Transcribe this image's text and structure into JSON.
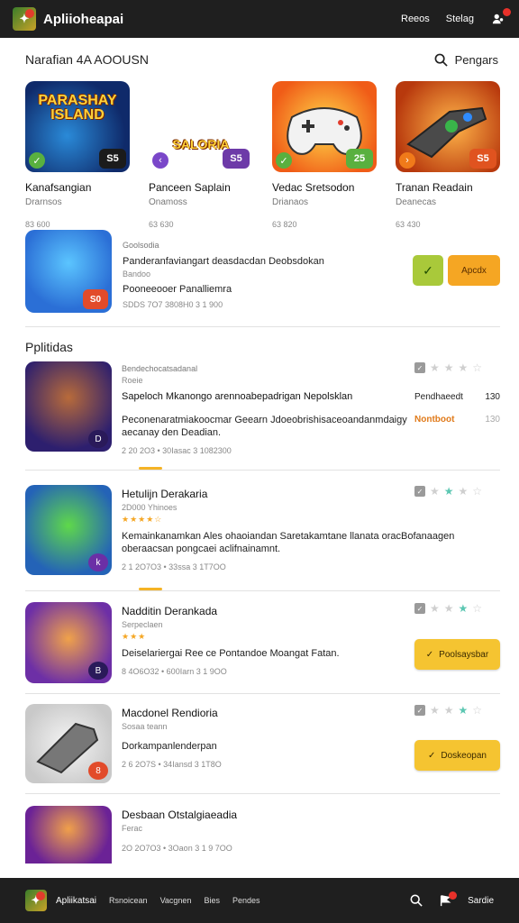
{
  "app": {
    "title": "Apliioheapai"
  },
  "topnav": {
    "item1": "Reeos",
    "item2": "Stelag",
    "icon": "user-icon"
  },
  "section1": {
    "title": "Narafian 4A AOOUSN",
    "search_label": "Pengars"
  },
  "cards": [
    {
      "art": "PARASHAY ISLAND",
      "score": "S5",
      "name": "Kanafsangian",
      "sub": "Drarnsos",
      "stat": "83 600"
    },
    {
      "art": "SALORIA",
      "score": "S5",
      "name": "Panceen Saplain",
      "sub": "Onamoss",
      "stat": "63 630"
    },
    {
      "art": "",
      "score": "25",
      "name": "Vedac Sretsodon",
      "sub": "Drianaos",
      "stat": "63 820"
    },
    {
      "art": "",
      "score": "S5",
      "name": "Tranan Readain",
      "sub": "Deanecas",
      "stat": "63 430"
    }
  ],
  "featured": {
    "label": "Goolsodia",
    "headline": "Panderanfaviangart deasdacdan Deobsdokan",
    "sub": "Bandoo",
    "title": "Pooneeooer Panalliemra",
    "meta": "SDDS 7O7 3808H0 3 1 900",
    "score": "S0",
    "accept_label": "Apcdx"
  },
  "section2": {
    "title": "Pplitidas"
  },
  "items": [
    {
      "category": "Bendechocatsadanal",
      "sub": "Roeie",
      "title": "Sapeloch Mkanongo arennoabepadrigan Nepolsklan",
      "desc": "Peconenaratmiakoocmar Geearn Jdoeobrishisaceoandanmdaigy aecanay den Deadian.",
      "meta": "2 20 2O3 • 30Iasac 3 1082300",
      "num": "D",
      "side1": "Pendhaeedt",
      "side1v": "130",
      "side2": "Nontboot",
      "side2v": "130"
    },
    {
      "category": "Hetulijn Derakaria",
      "sub": "2D000 Yhinoes",
      "title": "",
      "desc": "Kemainkanamkan Ales ohaoiandan Saretakamtane llanata oracBofanaagen oberaacsan pongcaei aclifnainamnt.",
      "meta": "2 1 2O7O3 • 33ssa 3 1T7OO",
      "num": "k",
      "stars": "★★★★☆"
    },
    {
      "category": "Nadditin Derankada",
      "sub": "Serpeclaen",
      "title": "",
      "desc": "Deiselariergai Ree ce Pontandoe Moangat Fatan.",
      "meta": "8 4O6O32 • 600Iarn 3 1 9OO",
      "num": "B",
      "stars": "★★★",
      "button": "Poolsaysbar"
    },
    {
      "category": "Macdonel Rendioria",
      "sub": "Sosaa teann",
      "title": "",
      "desc": "Dorkampanlenderpan",
      "meta": "2 6 2O7S • 34Iansd 3 1T8O",
      "num": "8",
      "button": "Doskeopan"
    },
    {
      "category": "Desbaan Otstalgiaeadia",
      "sub": "Ferac",
      "title": "",
      "desc": "",
      "meta": "2O 2O7O3 • 3Oaon 3 1 9 7OO",
      "num": ""
    }
  ],
  "bottombar": {
    "name": "Apliikatsai",
    "nav": [
      "Rsnoicean",
      "Vacgnen",
      "Bies",
      "Pendes"
    ],
    "right_label": "Sardie"
  },
  "colors": {
    "accent": "#f5c431",
    "topbar": "#1f1f1f",
    "check": "#a9c93a",
    "orange": "#f5a623"
  }
}
